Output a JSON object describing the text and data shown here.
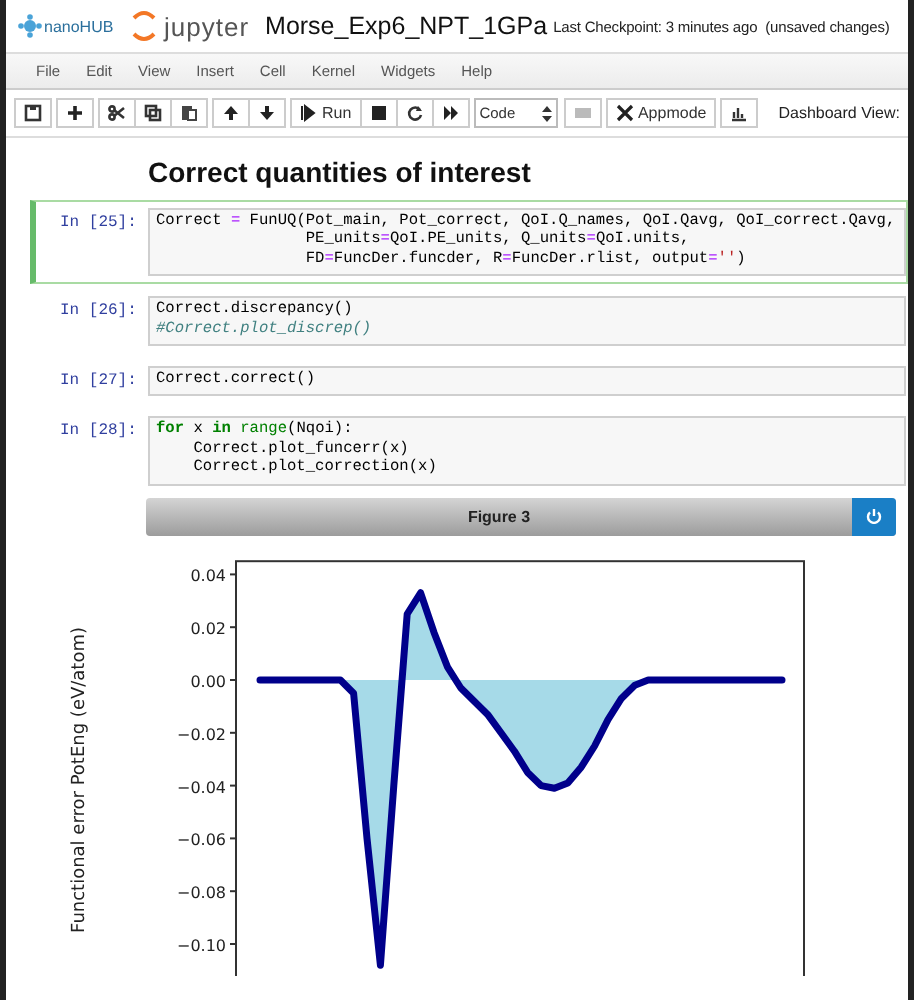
{
  "header": {
    "logo_text": "nanoHUB",
    "app_name": "jupyter",
    "notebook_title": "Morse_Exp6_NPT_1GPa",
    "checkpoint": "Last Checkpoint: 3 minutes ago",
    "save_state": "(unsaved changes)"
  },
  "menu": [
    "File",
    "Edit",
    "View",
    "Insert",
    "Cell",
    "Kernel",
    "Widgets",
    "Help"
  ],
  "toolbar": {
    "run_label": "Run",
    "cell_type": "Code",
    "appmode_label": "Appmode",
    "dashboard_label": "Dashboard View:"
  },
  "heading": "Correct quantities of interest",
  "cells": [
    {
      "prompt": "In [25]:",
      "selected": true,
      "lines": [
        [
          {
            "kind": "plain",
            "text": "Correct "
          },
          {
            "kind": "op",
            "text": "="
          },
          {
            "kind": "plain",
            "text": " FunUQ(Pot_main, Pot_correct, QoI.Q_names, QoI.Qavg, QoI_correct.Qavg,"
          }
        ],
        [
          {
            "kind": "plain",
            "text": "                PE_units"
          },
          {
            "kind": "op",
            "text": "="
          },
          {
            "kind": "plain",
            "text": "QoI.PE_units, Q_units"
          },
          {
            "kind": "op",
            "text": "="
          },
          {
            "kind": "plain",
            "text": "QoI.units,"
          }
        ],
        [
          {
            "kind": "plain",
            "text": "                FD"
          },
          {
            "kind": "op",
            "text": "="
          },
          {
            "kind": "plain",
            "text": "FuncDer.funcder, R"
          },
          {
            "kind": "op",
            "text": "="
          },
          {
            "kind": "plain",
            "text": "FuncDer.rlist, output"
          },
          {
            "kind": "op",
            "text": "="
          },
          {
            "kind": "string",
            "text": "''"
          },
          {
            "kind": "plain",
            "text": ")"
          }
        ]
      ]
    },
    {
      "prompt": "In [26]:",
      "selected": false,
      "lines": [
        [
          {
            "kind": "plain",
            "text": "Correct.discrepancy()"
          }
        ],
        [
          {
            "kind": "comment",
            "text": "#Correct.plot_discrep()"
          }
        ]
      ]
    },
    {
      "prompt": "In [27]:",
      "selected": false,
      "lines": [
        [
          {
            "kind": "plain",
            "text": "Correct.correct()"
          }
        ]
      ]
    },
    {
      "prompt": "In [28]:",
      "selected": false,
      "lines": [
        [
          {
            "kind": "keyword",
            "text": "for"
          },
          {
            "kind": "plain",
            "text": " x "
          },
          {
            "kind": "keyword",
            "text": "in"
          },
          {
            "kind": "builtin",
            "text": " range"
          },
          {
            "kind": "plain",
            "text": "(Nqoi):"
          }
        ],
        [
          {
            "kind": "plain",
            "text": "    Correct.plot_funcerr(x)"
          }
        ],
        [
          {
            "kind": "plain",
            "text": "    Correct.plot_correction(x)"
          }
        ]
      ]
    }
  ],
  "figure": {
    "title": "Figure 3",
    "chart_data": {
      "type": "area",
      "ylabel": "Functional error PotEng (eV/atom)",
      "ylim": [
        -0.12,
        0.045
      ],
      "yticks": [
        {
          "value": 0.04,
          "label": "0.04"
        },
        {
          "value": 0.02,
          "label": "0.02"
        },
        {
          "value": 0,
          "label": "0.00"
        },
        {
          "value": -0.02,
          "label": "−0.02"
        },
        {
          "value": -0.04,
          "label": "−0.04"
        },
        {
          "value": -0.06,
          "label": "−0.06"
        },
        {
          "value": -0.08,
          "label": "−0.08"
        },
        {
          "value": -0.1,
          "label": "−0.10"
        }
      ],
      "series": [
        {
          "color": "#00008b",
          "values": [
            0,
            0,
            0,
            0,
            0,
            0,
            0,
            -0.005,
            -0.06,
            -0.108,
            -0.04,
            0.025,
            0.033,
            0.018,
            0.005,
            -0.003,
            -0.008,
            -0.013,
            -0.02,
            -0.027,
            -0.035,
            -0.04,
            -0.041,
            -0.039,
            -0.033,
            -0.025,
            -0.015,
            -0.007,
            -0.002,
            0,
            0,
            0,
            0,
            0,
            0,
            0,
            0,
            0,
            0,
            0
          ]
        }
      ]
    }
  }
}
